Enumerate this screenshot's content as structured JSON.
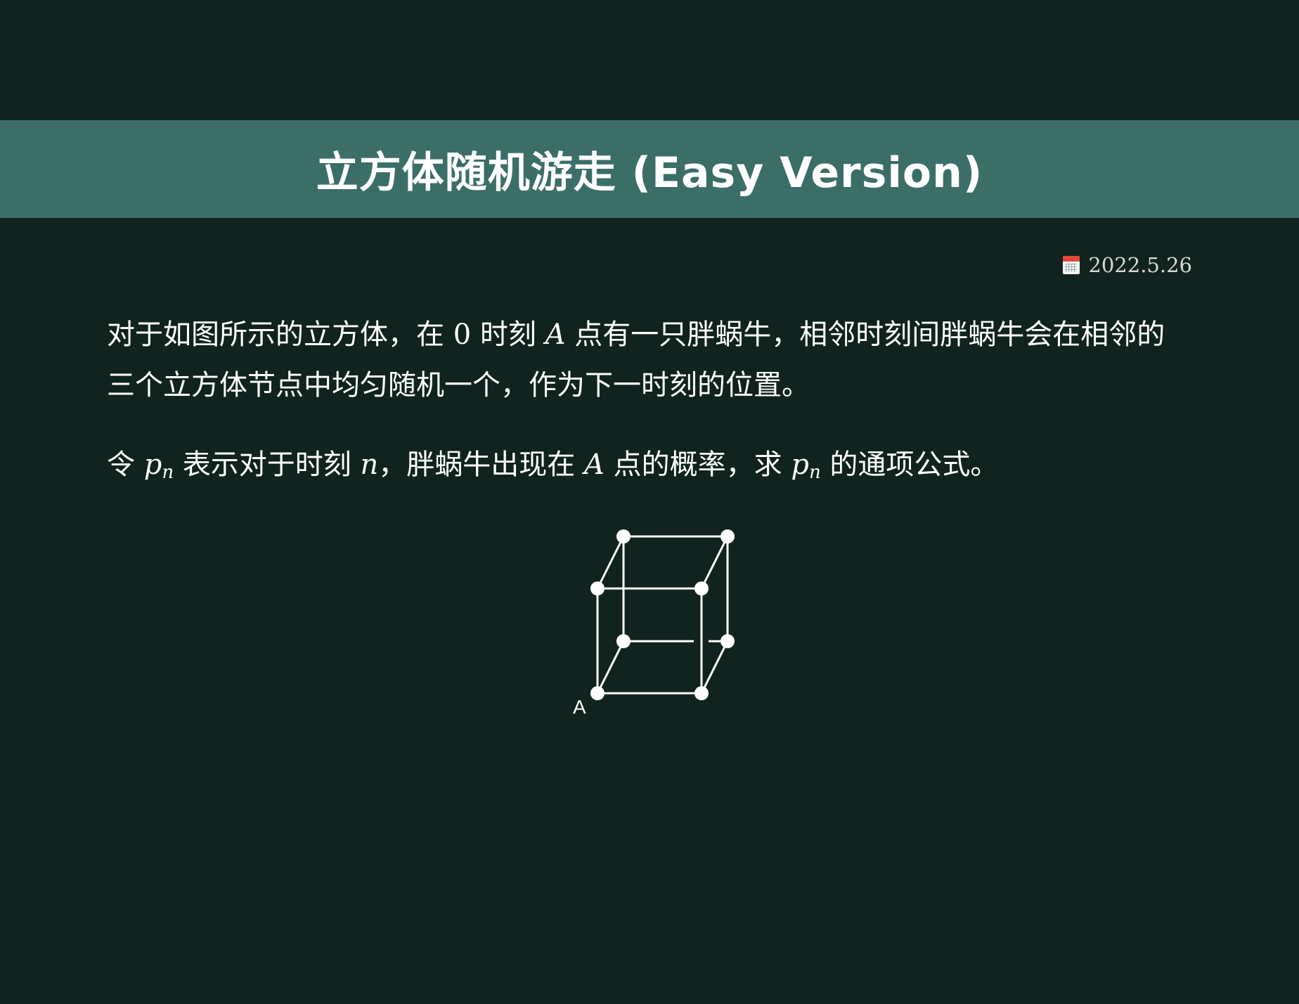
{
  "header": {
    "title": "立方体随机游走 (Easy Version)"
  },
  "meta": {
    "date": "2022.5.26",
    "date_icon": "calendar-icon"
  },
  "content": {
    "p1": {
      "s1": "对于如图所示的立方体，在 ",
      "zero": "0",
      "s2": " 时刻 ",
      "A": "A",
      "s3": " 点有一只胖蜗牛，相邻时刻间胖蜗牛会在相邻的三个立方体节点中均匀随机一个，作为下一时刻的位置。"
    },
    "p2": {
      "s1": "令 ",
      "p": "p",
      "n": "n",
      "s2": " 表示对于时刻 ",
      "n2": "n",
      "s3": "，胖蜗牛出现在 ",
      "A": "A",
      "s4": " 点的概率，求 ",
      "p2": "p",
      "n3": "n",
      "s5": " 的通项公式。"
    }
  },
  "figure": {
    "vertex_label": "A"
  }
}
